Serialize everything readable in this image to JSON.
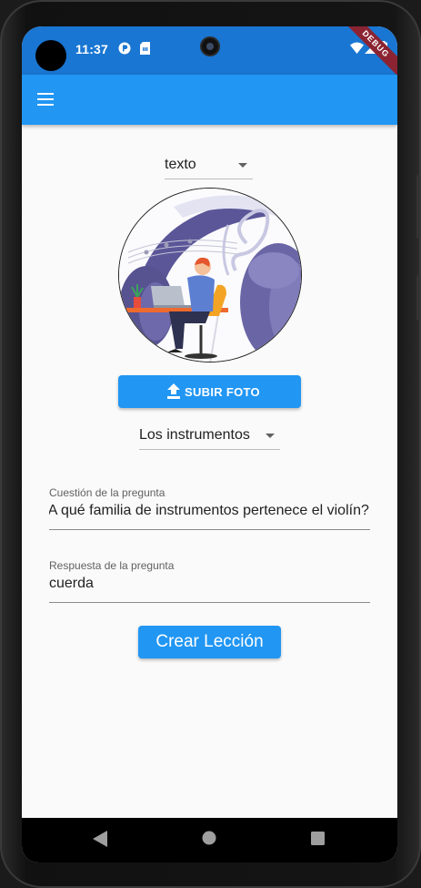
{
  "status_bar": {
    "time": "11:37",
    "debug_banner": "DEBUG",
    "icons": [
      "app-p-icon",
      "sim-card-icon",
      "wifi-icon",
      "signal-icon",
      "battery-icon"
    ],
    "color": "#1976d2"
  },
  "app_bar": {
    "menu_icon": "hamburger-menu-icon",
    "color": "#2196f3"
  },
  "form": {
    "type_dropdown": {
      "value": "texto"
    },
    "photo": {
      "description_icon": "music-illustration"
    },
    "upload_button": {
      "label": "SUBIR FOTO",
      "icon": "upload-icon"
    },
    "topic_dropdown": {
      "value": "Los instrumentos"
    },
    "question_field": {
      "label": "Cuestión de la pregunta",
      "value": "¿A qué familia de instrumentos pertenece el violín?"
    },
    "answer_field": {
      "label": "Respuesta de la pregunta",
      "value": "cuerda"
    },
    "create_button": {
      "label": "Crear Lección"
    }
  },
  "nav_bar": {
    "icons": [
      "back-icon",
      "home-icon",
      "recents-icon"
    ]
  }
}
